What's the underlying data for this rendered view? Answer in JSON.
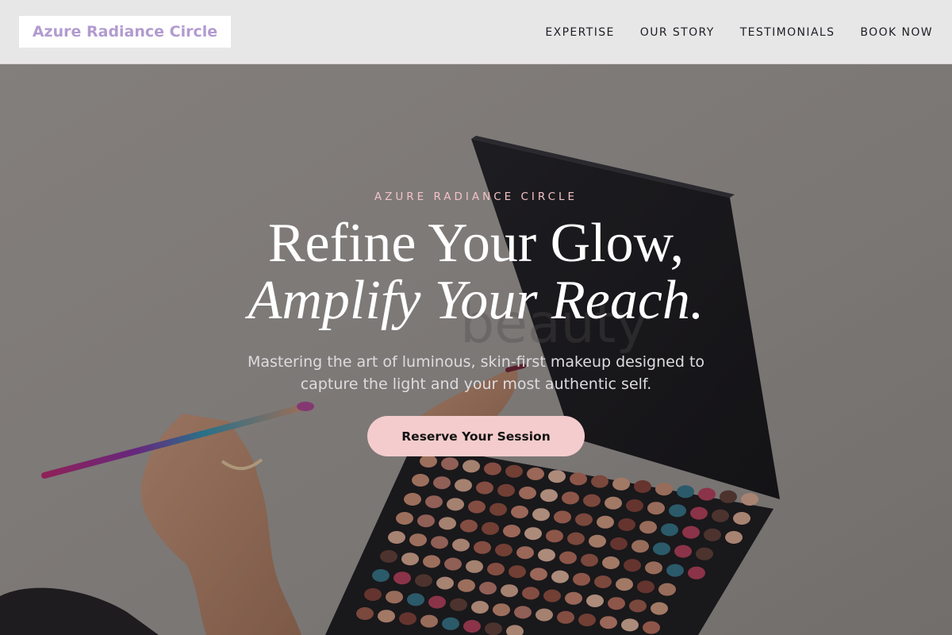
{
  "header": {
    "logo_text": "Azure Radiance Circle",
    "nav": [
      {
        "label": "EXPERTISE"
      },
      {
        "label": "OUR STORY"
      },
      {
        "label": "TESTIMONIALS"
      },
      {
        "label": "BOOK NOW"
      }
    ]
  },
  "hero": {
    "eyebrow": "AZURE RADIANCE CIRCLE",
    "headline_line1": "Refine Your Glow,",
    "headline_line2": "Amplify Your Reach.",
    "subtitle": "Mastering the art of luminous, skin-first makeup designed to capture the light and your most authentic self.",
    "cta_label": "Reserve Your Session",
    "background_image": "makeup-palette-photo",
    "watermark_text": "beauty"
  },
  "colors": {
    "logo_text": "#b29bd0",
    "header_bg": "#e8e7e7",
    "eyebrow": "#f2c3c6",
    "cta_bg": "#f4cccd"
  }
}
